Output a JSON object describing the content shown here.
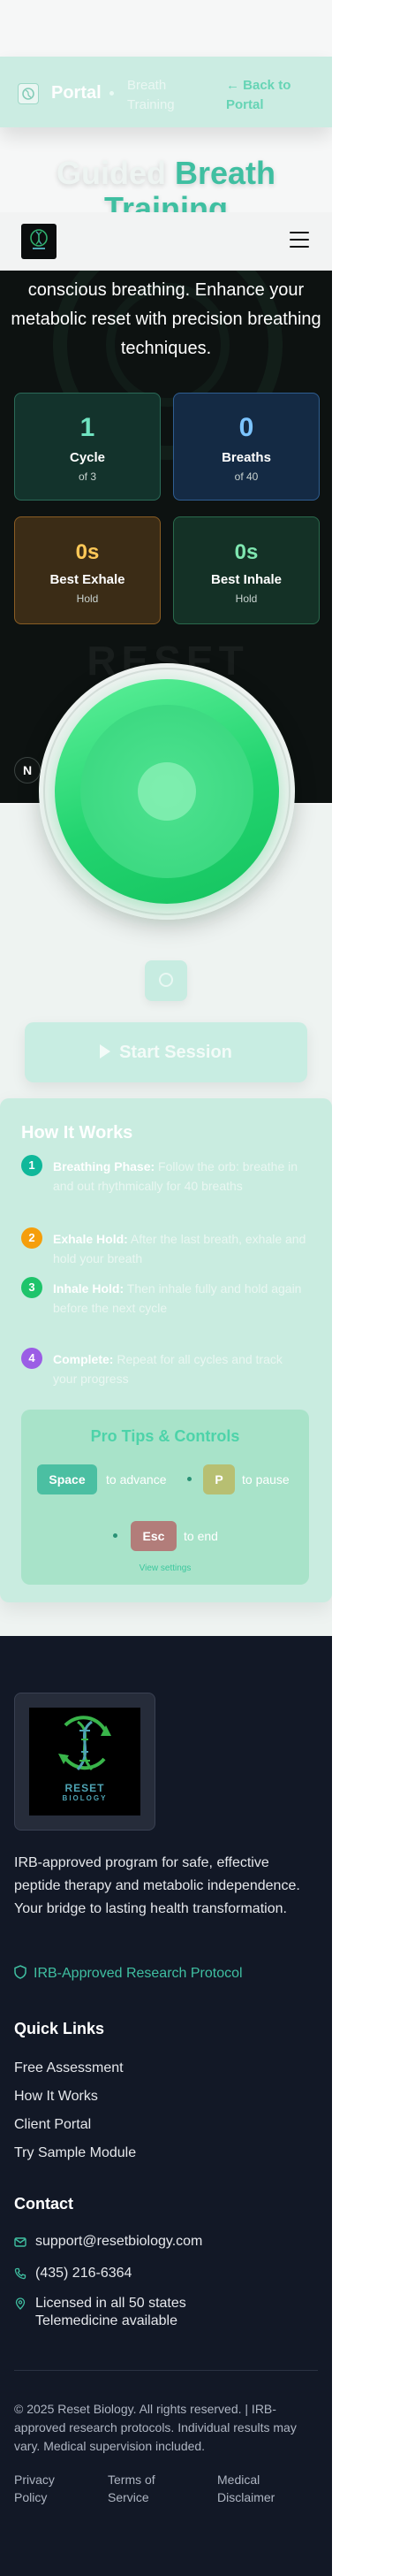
{
  "portal": {
    "label": "Portal",
    "crumb": "Breath Training",
    "back": "← Back to Portal"
  },
  "hero": {
    "title_a": "Guided",
    "title_b": "Breath",
    "title_c": "Training",
    "subtitle": "conscious breathing. Enhance your metabolic reset with precision breathing techniques."
  },
  "stats": {
    "cycle": {
      "value": "1",
      "label": "Cycle",
      "sub": "of 3"
    },
    "breaths": {
      "value": "0",
      "label": "Breaths",
      "sub": "of 40"
    },
    "exhale": {
      "value": "0s",
      "label": "Best Exhale",
      "sub": "Hold"
    },
    "inhale": {
      "value": "0s",
      "label": "Best Inhale",
      "sub": "Hold"
    }
  },
  "badge": "N",
  "ghost_text": "RESET",
  "start": {
    "label": "Start Session"
  },
  "how": {
    "title": "How It Works",
    "steps": [
      {
        "num": "1",
        "bold": "Breathing Phase:",
        "text": "Follow the orb: breathe in and out rhythmically for 40 breaths"
      },
      {
        "num": "2",
        "bold": "Exhale Hold:",
        "text": "After the last breath, exhale and hold your breath"
      },
      {
        "num": "3",
        "bold": "Inhale Hold:",
        "text": "Then inhale fully and hold again before the next cycle"
      },
      {
        "num": "4",
        "bold": "Complete:",
        "text": "Repeat for all cycles and track your progress"
      }
    ],
    "tips": {
      "title": "Pro Tips & Controls",
      "key_space": "Space",
      "to_advance": "to advance",
      "key_p": "P",
      "to_pause": "to pause",
      "key_esc": "Esc",
      "to_end": "to end",
      "link": "View settings"
    }
  },
  "footer": {
    "logo_text_1": "RESET",
    "logo_text_2": "BIOLOGY",
    "description": "IRB-approved program for safe, effective peptide therapy and metabolic independence. Your bridge to lasting health transformation.",
    "irb": "IRB-Approved Research Protocol",
    "links_title": "Quick Links",
    "links": [
      "Free Assessment",
      "How It Works",
      "Client Portal",
      "Try Sample Module"
    ],
    "contact_title": "Contact",
    "email": "support@resetbiology.com",
    "phone": "(435) 216-6364",
    "licensed": "Licensed in all 50 states",
    "telemedicine": "Telemedicine available",
    "copyright": "© 2025 Reset Biology. All rights reserved. | IRB-approved research protocols. Individual results may vary. Medical supervision included.",
    "legal": [
      "Privacy Policy",
      "Terms of Service",
      "Medical Disclaimer"
    ]
  },
  "colors": {
    "accent": "#3fbfa1",
    "orb_green": "#22d46f",
    "footer_bg": "#121826"
  }
}
